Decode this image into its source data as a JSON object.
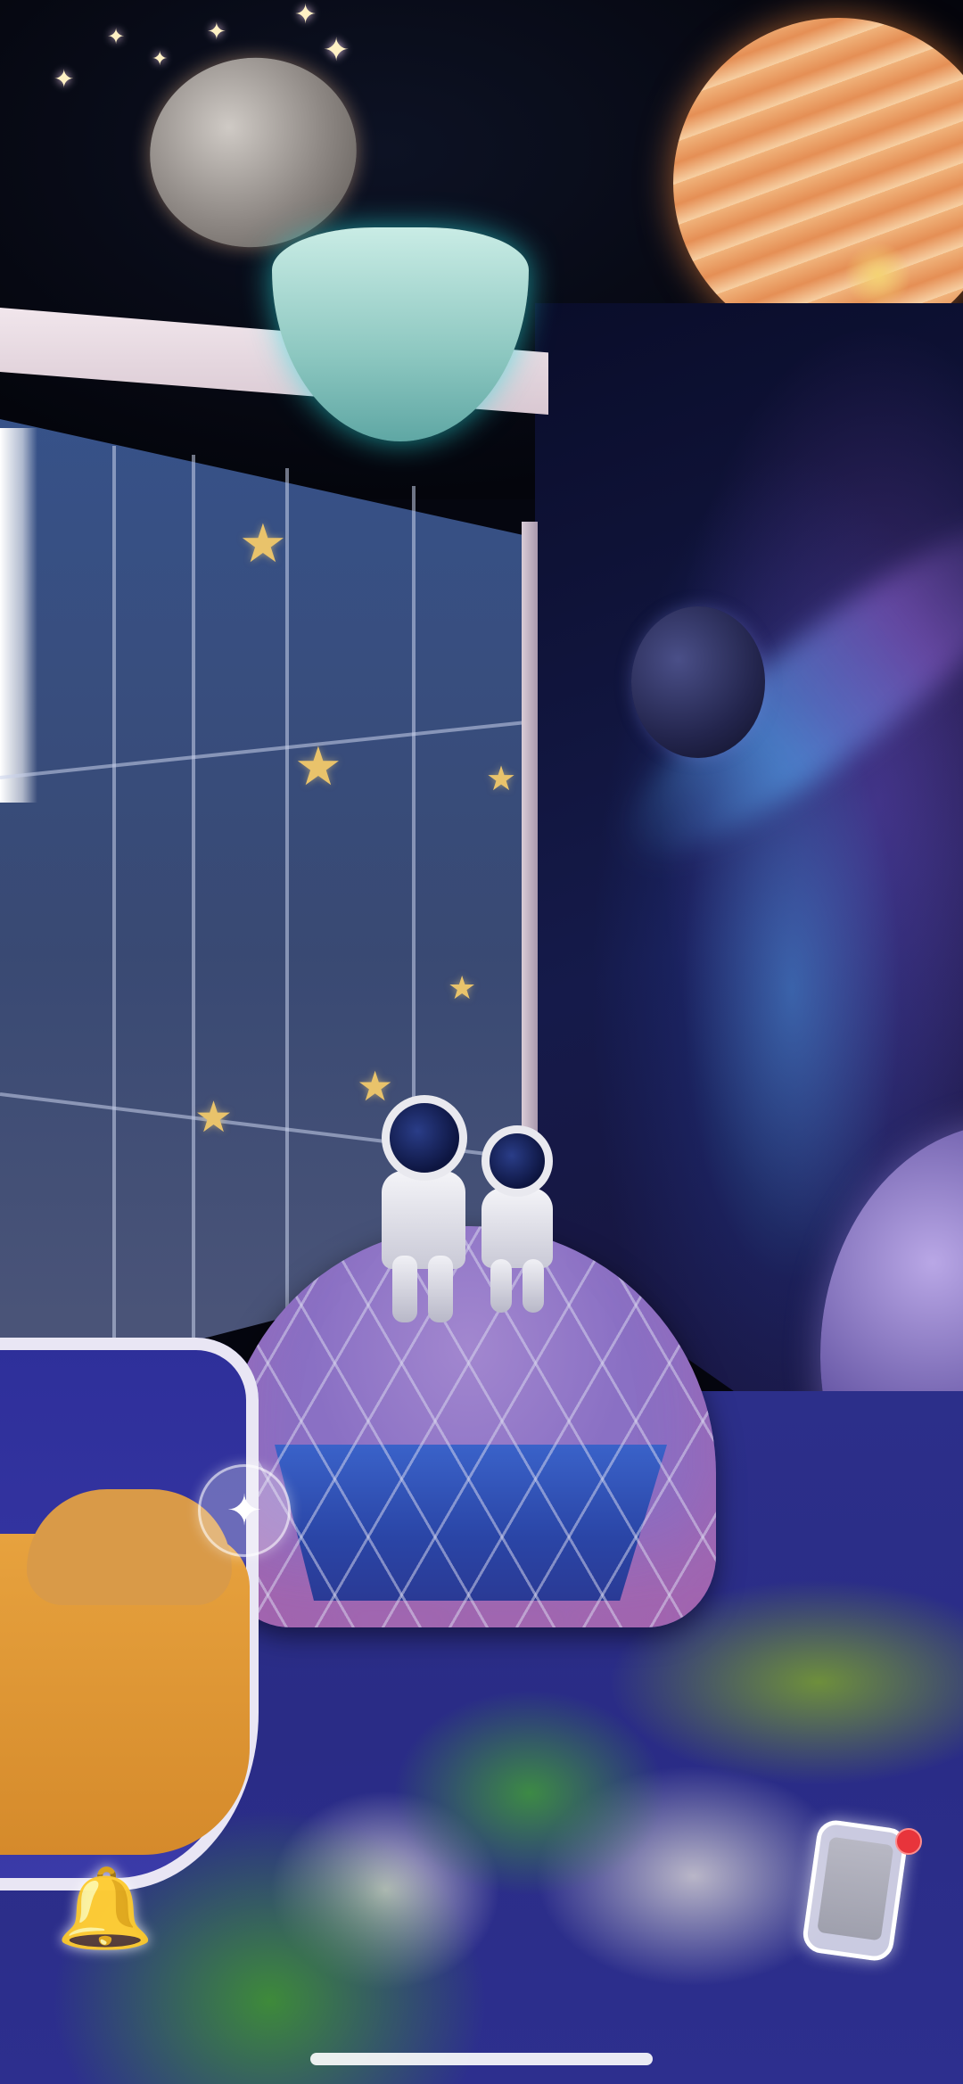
{
  "scene": {
    "accent_colors": {
      "sky": "#05060f",
      "galaxy_blue": "#4696e6",
      "dome_purple": "#8a70c4",
      "floor_blue": "#2c2f8a",
      "notification_red": "#e8343b"
    }
  },
  "controls": {
    "ar_move_icon": "four-point-sparkle-icon",
    "phone_icon": "phone-icon",
    "bell_icon": "bell-icon",
    "notification_badge": "red-dot"
  },
  "glyphs": {
    "sparkle": "✦",
    "star": "★",
    "bell": "🔔"
  }
}
